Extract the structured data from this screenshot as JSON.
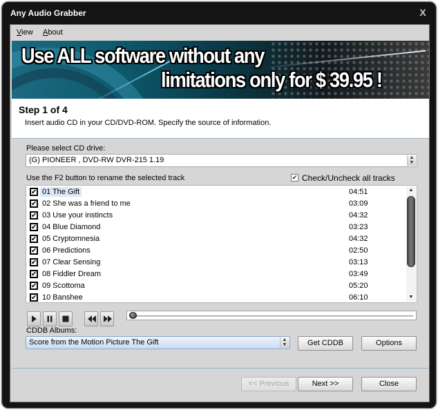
{
  "window": {
    "title": "Any Audio Grabber",
    "close_glyph": "X"
  },
  "menu": {
    "items": [
      {
        "label": "View",
        "accel": "V",
        "rest": "iew"
      },
      {
        "label": "About",
        "accel": "A",
        "rest": "bout"
      }
    ]
  },
  "banner": {
    "line1": "Use ALL software without any",
    "line2": "limitations only for $ 39.95 !"
  },
  "step": {
    "title": "Step 1 of 4",
    "description": "Insert audio CD in your CD/DVD-ROM. Specify the source of information."
  },
  "drive": {
    "label": "Please select CD drive:",
    "selected": "(G) PIONEER , DVD-RW  DVR-215   1.19"
  },
  "tracks": {
    "hint": "Use the F2 button to rename the selected track",
    "check_all_label": "Check/Uncheck all tracks",
    "check_all_checked": true,
    "selected_index": 0,
    "items": [
      {
        "name": "01 The Gift",
        "duration": "04:51",
        "checked": true
      },
      {
        "name": "02 She was a friend to me",
        "duration": "03:09",
        "checked": true
      },
      {
        "name": "03 Use your instincts",
        "duration": "04:32",
        "checked": true
      },
      {
        "name": "04 Blue Diamond",
        "duration": "03:23",
        "checked": true
      },
      {
        "name": "05 Cryptomnesia",
        "duration": "04:32",
        "checked": true
      },
      {
        "name": "06 Predictions",
        "duration": "02:50",
        "checked": true
      },
      {
        "name": "07 Clear Sensing",
        "duration": "03:13",
        "checked": true
      },
      {
        "name": "08 Fiddler Dream",
        "duration": "03:49",
        "checked": true
      },
      {
        "name": "09 Scottoma",
        "duration": "05:20",
        "checked": true
      },
      {
        "name": "10 Banshee",
        "duration": "06:10",
        "checked": true
      }
    ]
  },
  "player": {
    "controls": [
      "play",
      "pause",
      "stop",
      "rewind",
      "fast-forward"
    ],
    "position_fraction": 0.0
  },
  "cddb": {
    "label": "CDDB Albums:",
    "selected_album": "Score from the Motion Picture The Gift",
    "get_button": "Get CDDB",
    "options_button": "Options"
  },
  "footer": {
    "previous": "<< Previous",
    "previous_enabled": false,
    "next": "Next >>",
    "close": "Close"
  }
}
